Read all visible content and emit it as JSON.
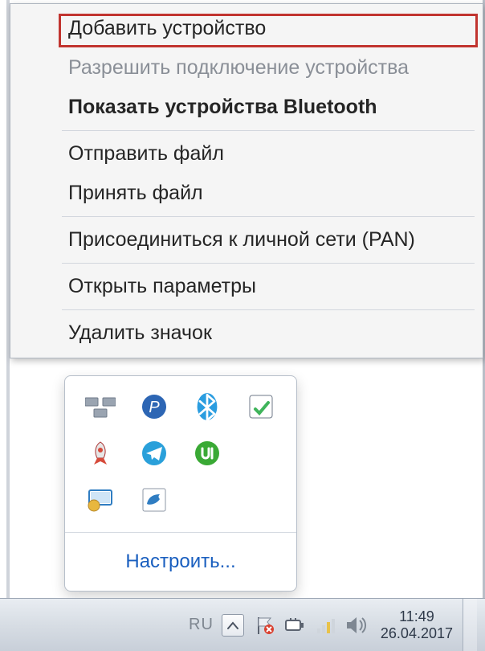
{
  "context_menu": {
    "items": [
      {
        "label": "Добавить устройство",
        "disabled": false,
        "bold": false,
        "highlighted": true
      },
      {
        "label": "Разрешить подключение устройства",
        "disabled": true,
        "bold": false
      },
      {
        "label": "Показать устройства Bluetooth",
        "disabled": false,
        "bold": true
      },
      {
        "sep": true
      },
      {
        "label": "Отправить файл",
        "disabled": false,
        "bold": false
      },
      {
        "label": "Принять файл",
        "disabled": false,
        "bold": false
      },
      {
        "sep": true
      },
      {
        "label": "Присоединиться к личной сети (PAN)",
        "disabled": false,
        "bold": false
      },
      {
        "sep": true
      },
      {
        "label": "Открыть параметры",
        "disabled": false,
        "bold": false
      },
      {
        "sep": true
      },
      {
        "label": "Удалить значок",
        "disabled": false,
        "bold": false
      }
    ]
  },
  "tray_popup": {
    "apps": [
      {
        "name": "drives-icon",
        "color": "#7f8b99"
      },
      {
        "name": "privacy-icon",
        "color": "#2d66b4"
      },
      {
        "name": "bluetooth-icon",
        "color": "#2b9de0"
      },
      {
        "name": "update-icon",
        "color": "#3fb45b"
      },
      {
        "name": "rocket-icon",
        "color": "#d64a3a"
      },
      {
        "name": "telegram-icon",
        "color": "#2aa0da"
      },
      {
        "name": "utorrent-icon",
        "color": "#3aa935"
      },
      {
        "name": "display-icon",
        "color": "#2f7dc2"
      },
      {
        "name": "bird-icon",
        "color": "#2f7dc2"
      }
    ],
    "customize_label": "Настроить..."
  },
  "taskbar": {
    "language": "RU",
    "tray_icons": [
      {
        "name": "flag-icon"
      },
      {
        "name": "power-icon"
      },
      {
        "name": "network-icon"
      },
      {
        "name": "volume-icon"
      }
    ],
    "clock": {
      "time": "11:49",
      "date": "26.04.2017"
    }
  }
}
